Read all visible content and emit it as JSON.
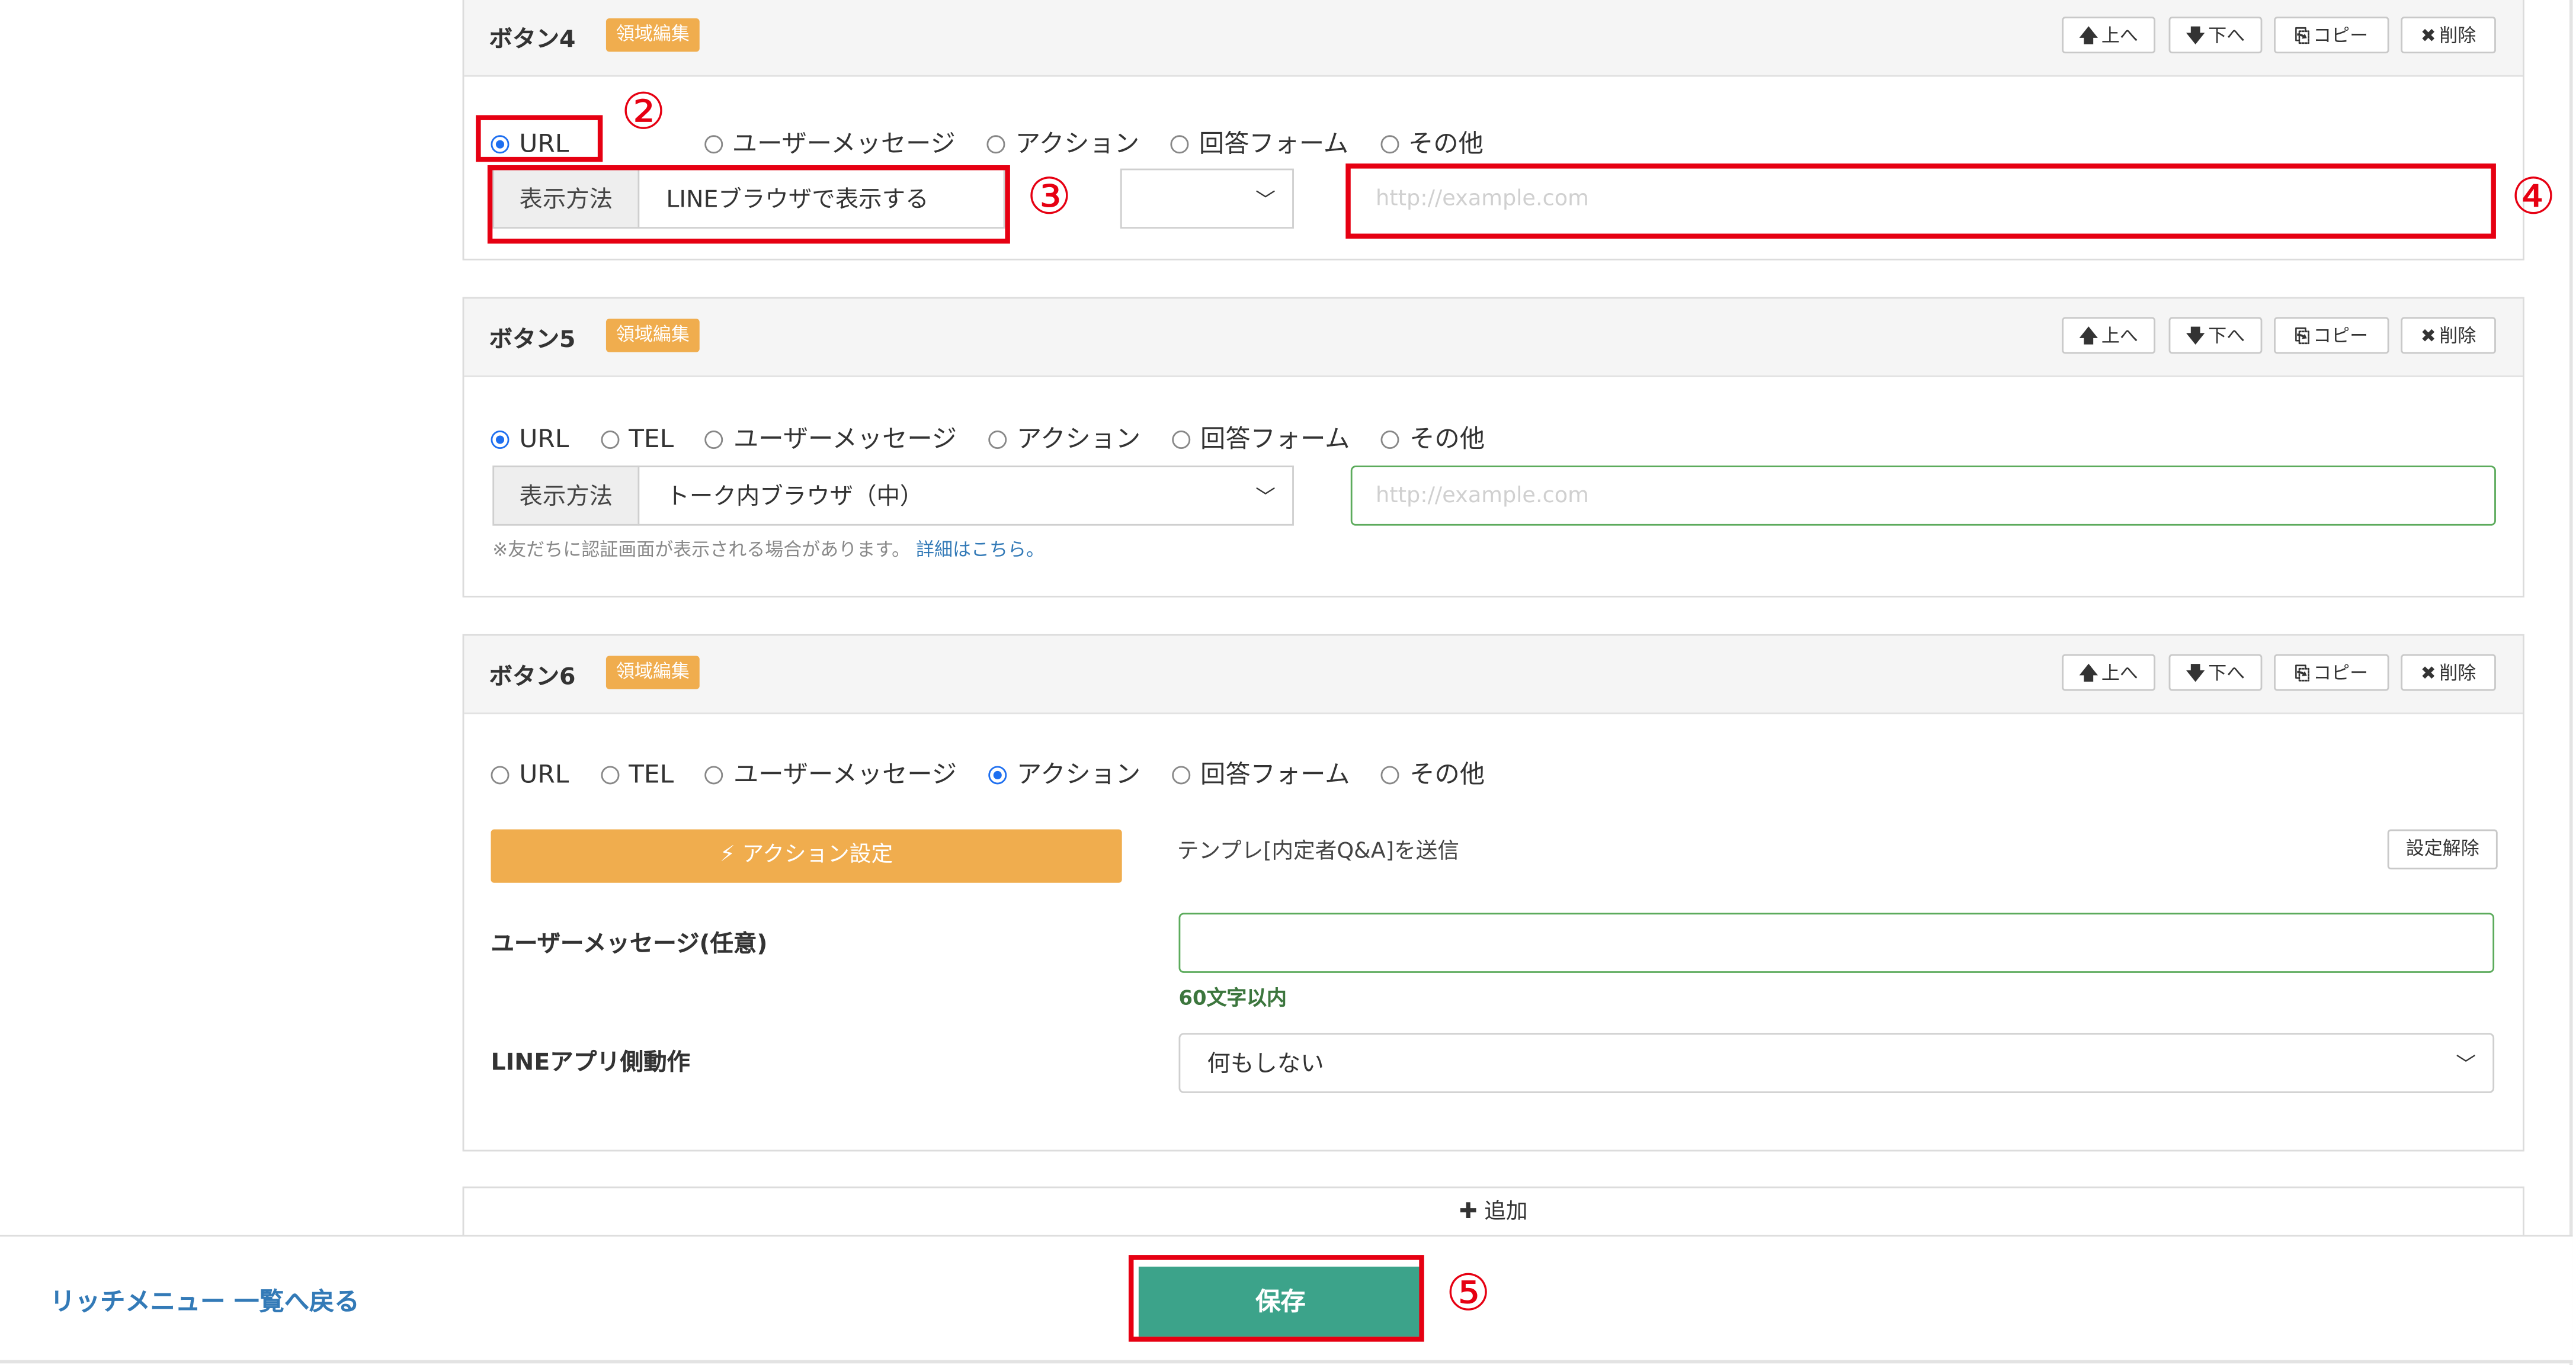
{
  "buttons": [
    {
      "title": "ボタン4",
      "region_badge": "領域編集",
      "header_actions": {
        "up": "上へ",
        "down": "下へ",
        "copy": "コピー",
        "delete": "削除"
      },
      "types": [
        "URL",
        "ユーザーメッセージ",
        "アクション",
        "回答フォーム",
        "その他"
      ],
      "selected_type": "URL",
      "display_label": "表示方法",
      "display_value": "LINEブラウザで表示する",
      "url_placeholder": "http://example.com"
    },
    {
      "title": "ボタン5",
      "region_badge": "領域編集",
      "header_actions": {
        "up": "上へ",
        "down": "下へ",
        "copy": "コピー",
        "delete": "削除"
      },
      "types": [
        "URL",
        "TEL",
        "ユーザーメッセージ",
        "アクション",
        "回答フォーム",
        "その他"
      ],
      "selected_type": "URL",
      "display_label": "表示方法",
      "display_value": "トーク内ブラウザ（中）",
      "url_placeholder": "http://example.com",
      "note": "※友だちに認証画面が表示される場合があります。",
      "note_link": "詳細はこちら。"
    },
    {
      "title": "ボタン6",
      "region_badge": "領域編集",
      "header_actions": {
        "up": "上へ",
        "down": "下へ",
        "copy": "コピー",
        "delete": "削除"
      },
      "types": [
        "URL",
        "TEL",
        "ユーザーメッセージ",
        "アクション",
        "回答フォーム",
        "その他"
      ],
      "selected_type": "アクション",
      "action_button": "アクション設定",
      "action_template": "テンプレ[内定者Q&A]を送信",
      "unset_button": "設定解除",
      "user_message_label": "ユーザーメッセージ(任意)",
      "user_message_value": "",
      "limit_note": "60文字以内",
      "app_action_label": "LINEアプリ側動作",
      "app_action_value": "何もしない"
    }
  ],
  "add_button": "追加",
  "footer": {
    "back_link": "リッチメニュー 一覧へ戻る",
    "save_button": "保存"
  },
  "annotations": {
    "n2": "②",
    "n3": "③",
    "n4": "④",
    "n5": "⑤"
  },
  "colors": {
    "badge": "#f0ad4e",
    "highlight": "#e60012",
    "save": "#3ca38a",
    "link": "#337ab7"
  }
}
